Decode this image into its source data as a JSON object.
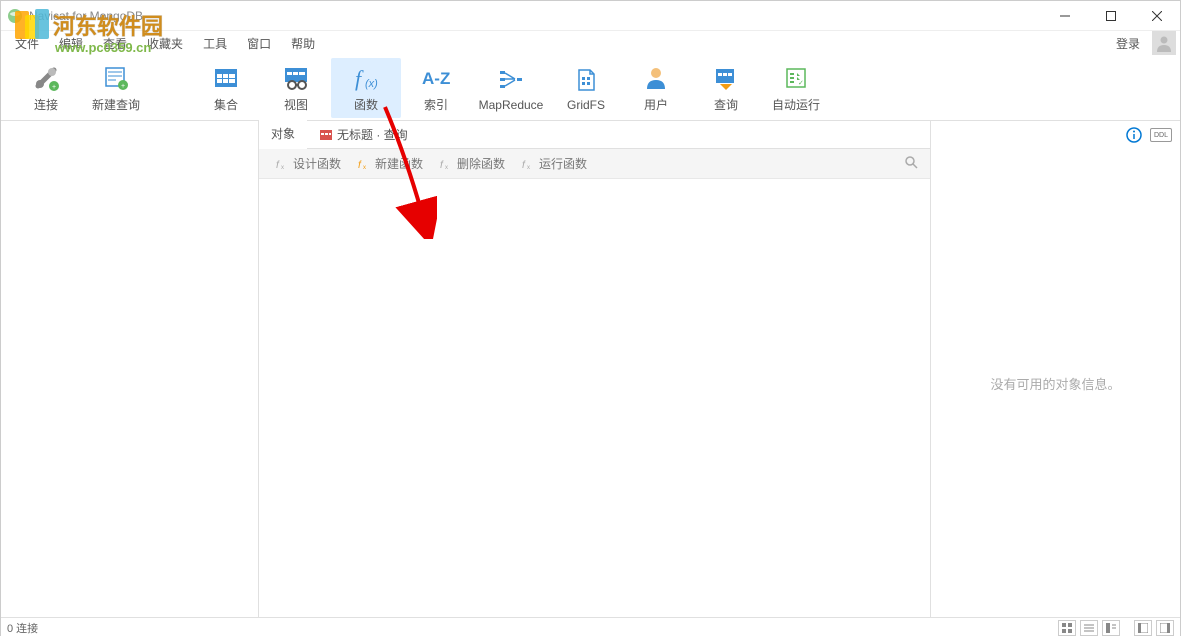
{
  "window": {
    "title": "Navicat for MongoDB"
  },
  "watermark": {
    "text": "河东软件园",
    "url": "www.pc0359.cn"
  },
  "menu": {
    "items": [
      "文件",
      "编辑",
      "查看",
      "收藏夹",
      "工具",
      "窗口",
      "帮助"
    ],
    "login": "登录"
  },
  "toolbar": {
    "items": [
      {
        "label": "连接",
        "name": "connect"
      },
      {
        "label": "新建查询",
        "name": "new-query"
      },
      {
        "label": "集合",
        "name": "collection"
      },
      {
        "label": "视图",
        "name": "view"
      },
      {
        "label": "函数",
        "name": "function",
        "active": true
      },
      {
        "label": "索引",
        "name": "index"
      },
      {
        "label": "MapReduce",
        "name": "mapreduce"
      },
      {
        "label": "GridFS",
        "name": "gridfs"
      },
      {
        "label": "用户",
        "name": "user"
      },
      {
        "label": "查询",
        "name": "query"
      },
      {
        "label": "自动运行",
        "name": "autorun"
      }
    ]
  },
  "tabs": {
    "t0": "对象",
    "t1": "无标题 · 查询"
  },
  "func_toolbar": {
    "design": "设计函数",
    "new": "新建函数",
    "delete": "删除函数",
    "run": "运行函数"
  },
  "right_panel": {
    "empty_message": "没有可用的对象信息。"
  },
  "status": {
    "connections": "0 连接"
  }
}
